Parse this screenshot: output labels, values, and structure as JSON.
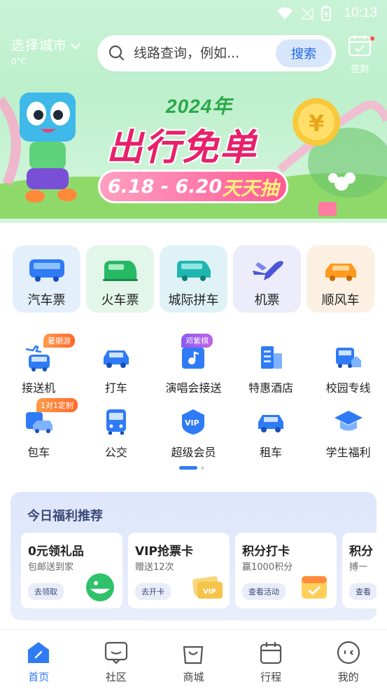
{
  "status_bar": {
    "time": "10:13"
  },
  "header": {
    "city_label": "选择城市",
    "temperature": "0°C",
    "search_placeholder": "线路查询，例如...",
    "search_button": "搜索",
    "checkin_label": "签到"
  },
  "banner": {
    "year": "2024年",
    "title": "出行免单",
    "date_range": "6.18 - 6.20",
    "date_accent": "天天抽"
  },
  "main_services": [
    {
      "label": "汽车票",
      "icon": "bus-icon"
    },
    {
      "label": "火车票",
      "icon": "train-icon"
    },
    {
      "label": "城际拼车",
      "icon": "van-icon"
    },
    {
      "label": "机票",
      "icon": "plane-icon"
    },
    {
      "label": "顺风车",
      "icon": "car-icon"
    }
  ],
  "grid_services": {
    "row1": [
      {
        "label": "接送机",
        "icon": "airport-shuttle-icon",
        "badge": "暑期游"
      },
      {
        "label": "打车",
        "icon": "taxi-icon"
      },
      {
        "label": "演唱会接送",
        "icon": "concert-icon",
        "badge": "邓紫棋"
      },
      {
        "label": "特惠酒店",
        "icon": "hotel-icon"
      },
      {
        "label": "校园专线",
        "icon": "campus-bus-icon"
      }
    ],
    "row2": [
      {
        "label": "包车",
        "icon": "charter-icon",
        "badge": "1对1定制"
      },
      {
        "label": "公交",
        "icon": "public-bus-icon"
      },
      {
        "label": "超级会员",
        "icon": "vip-icon"
      },
      {
        "label": "租车",
        "icon": "rental-car-icon"
      },
      {
        "label": "学生福利",
        "icon": "graduation-cap-icon"
      }
    ]
  },
  "welfare": {
    "title": "今日福利推荐",
    "cards": [
      {
        "title": "0元领礼品",
        "subtitle": "包邮送到家",
        "button": "去领取"
      },
      {
        "title": "VIP抢票卡",
        "subtitle": "赠送12次",
        "button": "去开卡"
      },
      {
        "title": "积分打卡",
        "subtitle": "赢1000积分",
        "button": "查看活动"
      },
      {
        "title": "积分",
        "subtitle": "搏一",
        "button": "查看"
      }
    ]
  },
  "bottom_nav": [
    {
      "label": "首页",
      "active": true
    },
    {
      "label": "社区"
    },
    {
      "label": "商城"
    },
    {
      "label": "行程"
    },
    {
      "label": "我的"
    }
  ],
  "colors": {
    "accent": "#2f7bf5",
    "banner_pink": "#e8206a",
    "header_green": "#bdf0cc"
  }
}
